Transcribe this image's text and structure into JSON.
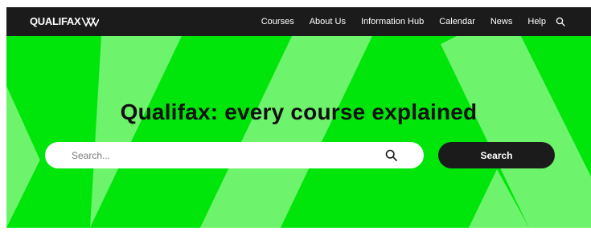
{
  "header": {
    "logo_text": "QUALIFAX",
    "logo_mark_icon": "chevron-stripes-logo-mark",
    "nav": [
      {
        "label": "Courses"
      },
      {
        "label": "About Us"
      },
      {
        "label": "Information Hub"
      },
      {
        "label": "Calendar"
      },
      {
        "label": "News"
      },
      {
        "label": "Help"
      }
    ],
    "search_icon": "search-icon"
  },
  "hero": {
    "title": "Qualifax: every course explained",
    "search": {
      "placeholder": "Search...",
      "value": ""
    },
    "search_button_label": "Search"
  },
  "colors": {
    "brand_green": "#00e60b",
    "light_green": "#6ef36c",
    "dark": "#1b1b1b",
    "white": "#ffffff"
  }
}
